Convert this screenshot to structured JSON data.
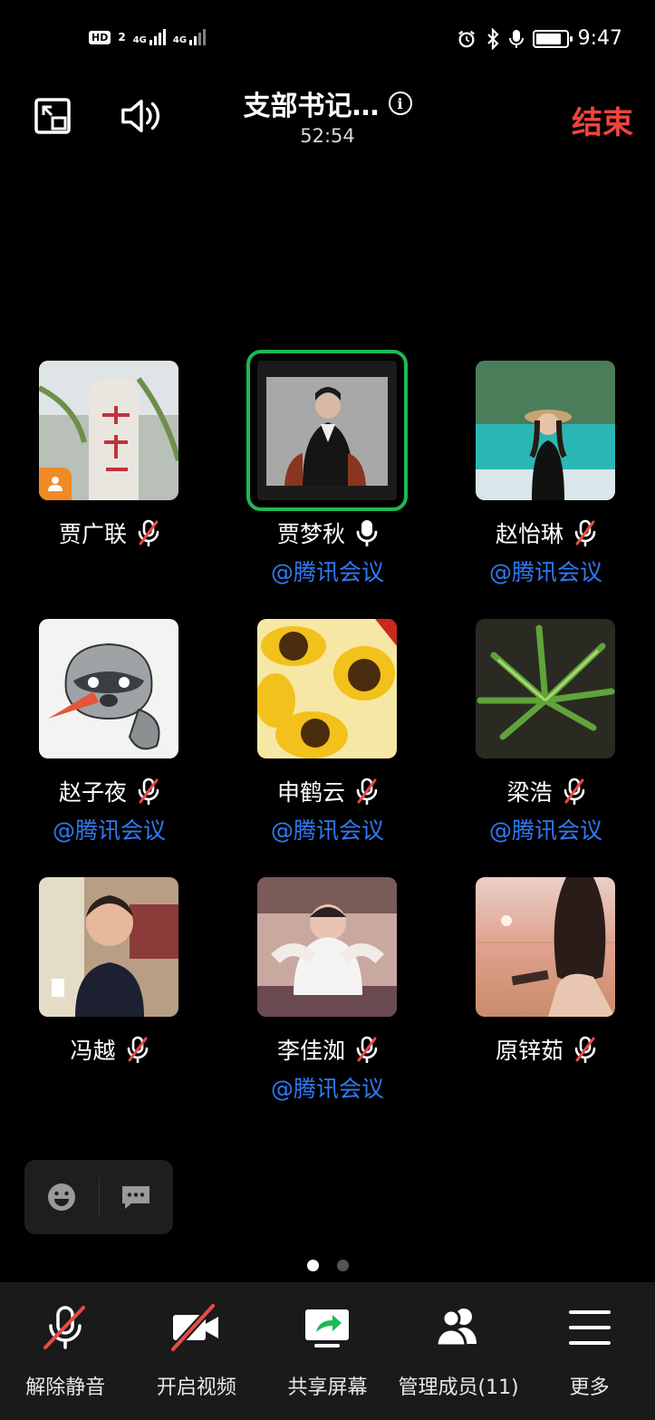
{
  "status_bar": {
    "hd": "HD",
    "sim_slot": "2",
    "net1": "4G",
    "net2": "4G",
    "time": "9:47",
    "battery_level": 0.85
  },
  "meeting": {
    "title": "支部书记…",
    "duration": "52:54",
    "end_label": "结束"
  },
  "participants": [
    {
      "name": "贾广联",
      "tag": "",
      "mic": "muted",
      "host": true,
      "speaking": false,
      "avatar": "tree"
    },
    {
      "name": "贾梦秋",
      "tag": "@腾讯会议",
      "mic": "on",
      "host": false,
      "speaking": true,
      "avatar": "portrait"
    },
    {
      "name": "赵怡琳",
      "tag": "@腾讯会议",
      "mic": "muted",
      "host": false,
      "speaking": false,
      "avatar": "lake"
    },
    {
      "name": "赵子夜",
      "tag": "@腾讯会议",
      "mic": "muted",
      "host": false,
      "speaking": false,
      "avatar": "raccoon"
    },
    {
      "name": "申鹤云",
      "tag": "@腾讯会议",
      "mic": "muted",
      "host": false,
      "speaking": false,
      "avatar": "sunflower"
    },
    {
      "name": "梁浩",
      "tag": "@腾讯会议",
      "mic": "muted",
      "host": false,
      "speaking": false,
      "avatar": "leaves"
    },
    {
      "name": "冯越",
      "tag": "",
      "mic": "muted",
      "host": false,
      "speaking": false,
      "avatar": "child"
    },
    {
      "name": "李佳洳",
      "tag": "@腾讯会议",
      "mic": "muted",
      "host": false,
      "speaking": false,
      "avatar": "baby"
    },
    {
      "name": "原锌茹",
      "tag": "",
      "mic": "muted",
      "host": false,
      "speaking": false,
      "avatar": "sunset"
    }
  ],
  "pagination": {
    "page": 1,
    "total": 2
  },
  "toolbar": {
    "unmute": "解除静音",
    "video": "开启视频",
    "share": "共享屏幕",
    "members": "管理成员(11)",
    "more": "更多"
  },
  "colors": {
    "end": "#f0443e",
    "tag": "#2f7af5",
    "speaking": "#1db954",
    "host_badge": "#f08a24"
  }
}
